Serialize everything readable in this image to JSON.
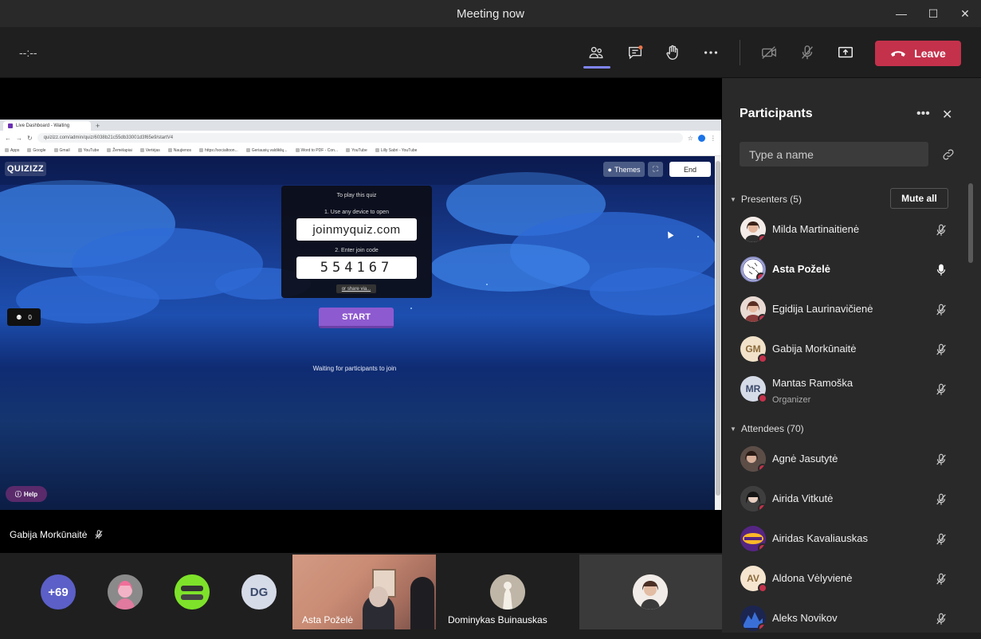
{
  "window": {
    "title": "Meeting now"
  },
  "toolbar": {
    "timer": "--:--",
    "leave_label": "Leave"
  },
  "browser": {
    "tab_title": "Live Dashboard - Waiting",
    "url": "quizizz.com/admin/quiz/6038b21c55db33001d3f65e9/startV4",
    "bookmarks": [
      "Apps",
      "Google",
      "Gmail",
      "YouTube",
      "Žemėlapiai",
      "Vertėjas",
      "Naujienos",
      "https://socialtoon...",
      "Geriausių valdiklių...",
      "Word to PDF - Con...",
      "YouTube",
      "Lilly Sabri - YouTube"
    ]
  },
  "quiz": {
    "logo": "QUIZIZZ",
    "themes_label": "Themes",
    "end_label": "End",
    "card_title": "To play this quiz",
    "step1": "1. Use any device to open",
    "join_url": "joinmyquiz.com",
    "step2": "2. Enter join code",
    "join_code": "554167",
    "share_label": "or share via...",
    "start_label": "START",
    "waiting_text": "Waiting for participants to join",
    "player_count": "0",
    "help_label": "Help"
  },
  "stage": {
    "presenter_name": "Gabija Morkūnaitė"
  },
  "filmstrip": {
    "overflow_count": "+69",
    "dg_initials": "DG",
    "tile1_name": "Asta Poželė",
    "tile2_name": "Dominykas Buinauskas"
  },
  "panel": {
    "title": "Participants",
    "search_placeholder": "Type a name",
    "presenters_header": "Presenters (5)",
    "mute_all_label": "Mute all",
    "attendees_header": "Attendees (70)",
    "presenters": [
      {
        "name": "Milda Martinaitienė",
        "initials": "",
        "role": "",
        "mic": "muted"
      },
      {
        "name": "Asta Poželė",
        "initials": "",
        "role": "",
        "mic": "active"
      },
      {
        "name": "Egidija Laurinavičienė",
        "initials": "",
        "role": "",
        "mic": "muted"
      },
      {
        "name": "Gabija Morkūnaitė",
        "initials": "GM",
        "role": "",
        "mic": "muted"
      },
      {
        "name": "Mantas Ramoška",
        "initials": "MR",
        "role": "Organizer",
        "mic": "muted"
      }
    ],
    "attendees": [
      {
        "name": "Agnė Jasutytė",
        "initials": "",
        "mic": "muted"
      },
      {
        "name": "Airida Vitkutė",
        "initials": "",
        "mic": "muted"
      },
      {
        "name": "Airidas Kavaliauskas",
        "initials": "",
        "mic": "muted"
      },
      {
        "name": "Aldona Vėlyvienė",
        "initials": "AV",
        "mic": "muted"
      },
      {
        "name": "Aleks Novikov",
        "initials": "",
        "mic": "muted"
      }
    ]
  },
  "colors": {
    "accent": "#7f85f5",
    "leave": "#c4314b",
    "panel_bg": "#292929"
  }
}
